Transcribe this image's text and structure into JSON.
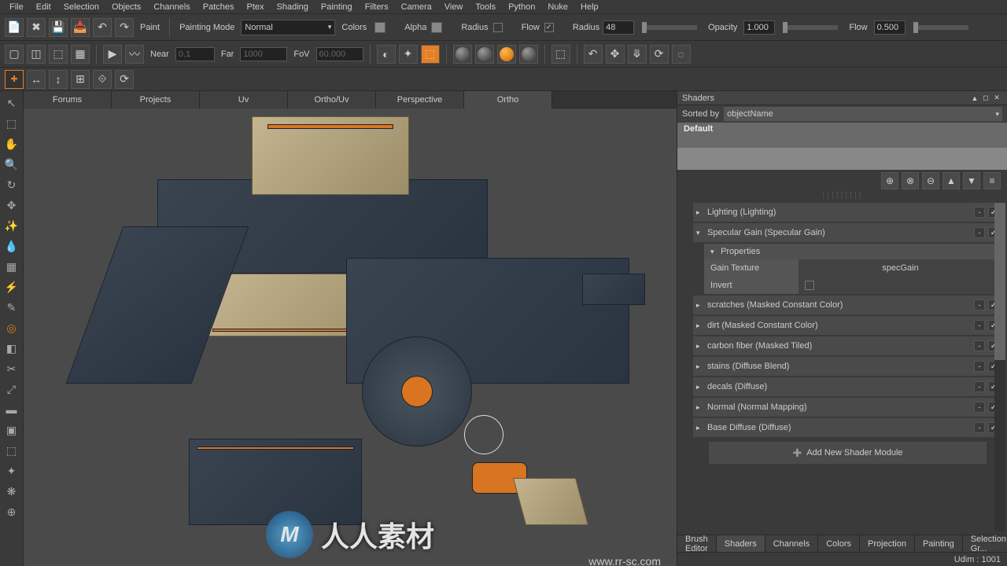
{
  "menubar": [
    "File",
    "Edit",
    "Selection",
    "Objects",
    "Channels",
    "Patches",
    "Ptex",
    "Shading",
    "Painting",
    "Filters",
    "Camera",
    "View",
    "Tools",
    "Python",
    "Nuke",
    "Help"
  ],
  "toolbar1": {
    "paint_label": "Paint",
    "mode_label": "Painting Mode",
    "mode_value": "Normal",
    "colors_label": "Colors",
    "alpha_label": "Alpha",
    "radius1_label": "Radius",
    "flow1_label": "Flow",
    "radius2_label": "Radius",
    "radius2_value": "48",
    "opacity_label": "Opacity",
    "opacity_value": "1.000",
    "flow2_label": "Flow",
    "flow2_value": "0.500"
  },
  "toolbar2": {
    "near_label": "Near",
    "near_value": "0.1",
    "far_label": "Far",
    "far_value": "1000",
    "fov_label": "FoV",
    "fov_value": "60.000"
  },
  "viewtabs": [
    "Forums",
    "Projects",
    "Uv",
    "Ortho/Uv",
    "Perspective",
    "Ortho"
  ],
  "active_viewtab": "Ortho",
  "shaders_panel": {
    "title": "Shaders",
    "sorted_by_label": "Sorted by",
    "sorted_by_value": "objectName",
    "list": [
      "Default",
      ""
    ],
    "layers": [
      {
        "name": "Lighting (Lighting)",
        "checked": true
      },
      {
        "name": "Specular Gain (Specular Gain)",
        "checked": true,
        "expanded": true
      },
      {
        "name": "scratches (Masked Constant Color)",
        "checked": true
      },
      {
        "name": "dirt (Masked Constant Color)",
        "checked": true
      },
      {
        "name": "carbon fiber (Masked Tiled)",
        "checked": true
      },
      {
        "name": "stains (Diffuse Blend)",
        "checked": true
      },
      {
        "name": "decals (Diffuse)",
        "checked": true
      },
      {
        "name": "Normal (Normal Mapping)",
        "checked": true
      },
      {
        "name": "Base Diffuse (Diffuse)",
        "checked": true
      }
    ],
    "properties": {
      "header": "Properties",
      "gain_label": "Gain Texture",
      "gain_value": "specGain",
      "invert_label": "Invert"
    },
    "add_module": "Add New Shader Module"
  },
  "bottom_tabs": [
    "Brush Editor",
    "Shaders",
    "Channels",
    "Colors",
    "Projection",
    "Painting",
    "Selection Gr..."
  ],
  "active_bottom_tab": "Shaders",
  "status": {
    "udim": "Udim : 1001"
  },
  "watermark": {
    "logo": "M",
    "text": "人人素材",
    "url": "www.rr-sc.com"
  }
}
